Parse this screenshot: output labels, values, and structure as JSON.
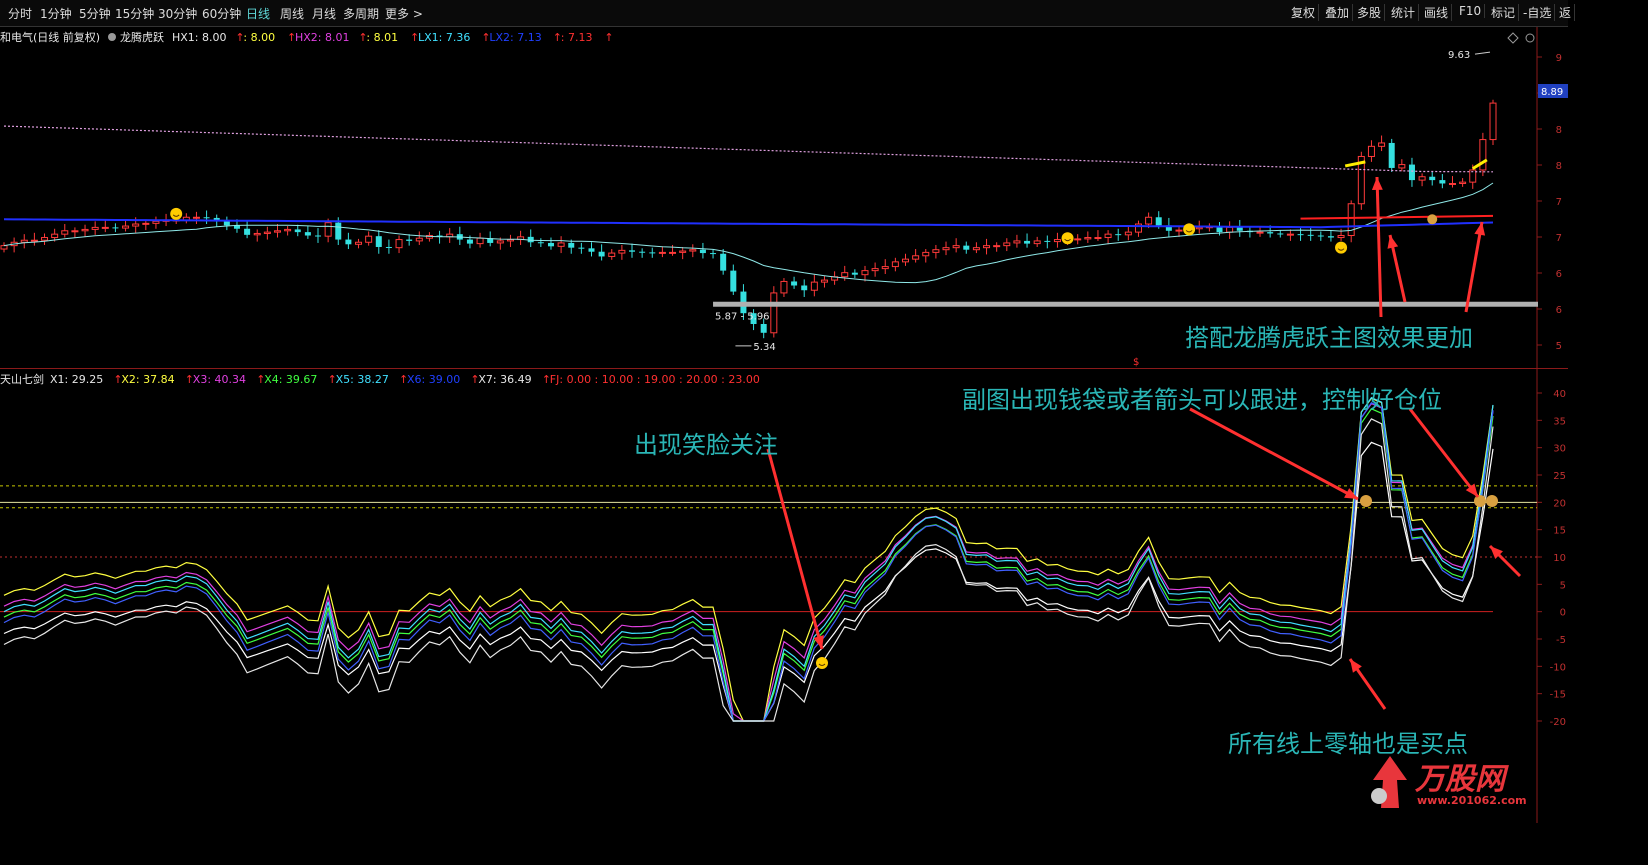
{
  "toolbar": {
    "periods": [
      "分时",
      "1分钟",
      "5分钟",
      "15分钟",
      "30分钟",
      "60分钟",
      "日线",
      "周线",
      "月线",
      "多周期",
      "更多 >"
    ],
    "active": "日线",
    "right_buttons": [
      "复权",
      "叠加",
      "多股",
      "统计",
      "画线",
      "F10",
      "标记",
      "-自选",
      "返"
    ]
  },
  "main_legend": {
    "stock": "和电气(日线 前复权)",
    "indicator": "龙腾虎跃",
    "items": [
      {
        "label": "HX1: 8.00",
        "color": "#e6e6e6"
      },
      {
        "label": "↑",
        "color": "#ff3030"
      },
      {
        "label": ": 8.00",
        "color": "#ffff40"
      },
      {
        "label": "↑",
        "color": "#ff3030"
      },
      {
        "label": "HX2: 8.01",
        "color": "#e040e0"
      },
      {
        "label": "↑",
        "color": "#ff3030"
      },
      {
        "label": ": 8.01",
        "color": "#ffff40"
      },
      {
        "label": "↑",
        "color": "#ff3030"
      },
      {
        "label": "LX1: 7.36",
        "color": "#40e0ff"
      },
      {
        "label": "↑",
        "color": "#ff3030"
      },
      {
        "label": "LX2: 7.13",
        "color": "#2040ff"
      },
      {
        "label": "↑",
        "color": "#ff3030"
      },
      {
        "label": ": 7.13",
        "color": "#ff3030"
      },
      {
        "label": "↑",
        "color": "#ff3030"
      }
    ]
  },
  "main_chart": {
    "price_axis_ticks": [
      "9",
      "9",
      "8",
      "8",
      "7",
      "7",
      "6",
      "6",
      "5"
    ],
    "current_price": "8.89",
    "high_label": "9.63",
    "low_label": "5.34",
    "support_label": "5.87 - 5.96",
    "s_marker": "$"
  },
  "sub_legend": {
    "indicator": "天山七剑",
    "items": [
      {
        "label": "X1: 29.25",
        "color": "#e6e6e6"
      },
      {
        "label": "↑",
        "color": "#ff3030"
      },
      {
        "label": "X2: 37.84",
        "color": "#ffff40"
      },
      {
        "label": "↑",
        "color": "#ff3030"
      },
      {
        "label": "X3: 40.34",
        "color": "#e040e0"
      },
      {
        "label": "↑",
        "color": "#ff3030"
      },
      {
        "label": "X4: 39.67",
        "color": "#40ff40"
      },
      {
        "label": "↑",
        "color": "#ff3030"
      },
      {
        "label": "X5: 38.27",
        "color": "#40e0ff"
      },
      {
        "label": "↑",
        "color": "#ff3030"
      },
      {
        "label": "X6: 39.00",
        "color": "#2040ff"
      },
      {
        "label": "↑",
        "color": "#ff3030"
      },
      {
        "label": "X7: 36.49",
        "color": "#e6e6e6"
      },
      {
        "label": "↑",
        "color": "#ff3030"
      },
      {
        "label": "FJ: 0.00 : 10.00 : 19.00 : 20.00 : 23.00",
        "color": "#ff3030"
      }
    ],
    "axis_ticks": [
      "40",
      "35",
      "30",
      "25",
      "20",
      "15",
      "10",
      "5",
      "0",
      "-5",
      "-10",
      "-15",
      "-20"
    ]
  },
  "chart_data": {
    "type": "candlestick",
    "closes": [
      6.78,
      6.83,
      6.86,
      6.86,
      6.9,
      6.95,
      7.0,
      7.0,
      7.02,
      7.05,
      7.05,
      7.04,
      7.07,
      7.1,
      7.11,
      7.14,
      7.16,
      7.16,
      7.2,
      7.2,
      7.19,
      7.14,
      7.08,
      7.03,
      6.94,
      6.96,
      6.98,
      7.0,
      7.02,
      6.98,
      6.93,
      6.92,
      7.12,
      6.87,
      6.8,
      6.83,
      6.92,
      6.76,
      6.75,
      6.87,
      6.85,
      6.89,
      6.93,
      6.91,
      6.95,
      6.87,
      6.81,
      6.89,
      6.82,
      6.85,
      6.87,
      6.91,
      6.83,
      6.82,
      6.77,
      6.82,
      6.75,
      6.74,
      6.69,
      6.62,
      6.67,
      6.71,
      6.69,
      6.68,
      6.67,
      6.68,
      6.68,
      6.7,
      6.72,
      6.67,
      6.66,
      6.41,
      6.1,
      5.78,
      5.62,
      5.49,
      6.08,
      6.25,
      6.19,
      6.12,
      6.24,
      6.27,
      6.32,
      6.38,
      6.35,
      6.41,
      6.44,
      6.47,
      6.54,
      6.58,
      6.63,
      6.68,
      6.72,
      6.75,
      6.78,
      6.72,
      6.75,
      6.78,
      6.78,
      6.82,
      6.85,
      6.81,
      6.85,
      6.84,
      6.87,
      6.87,
      6.88,
      6.9,
      6.9,
      6.95,
      6.94,
      6.98,
      7.1,
      7.2,
      7.08,
      7.0,
      7.01,
      7.03,
      7.05,
      7.06,
      6.98,
      7.05,
      7.0,
      6.98,
      6.98,
      6.96,
      6.95,
      6.95,
      6.94,
      6.93,
      6.92,
      6.9,
      6.93,
      7.4,
      8.1,
      8.25,
      8.3,
      7.93,
      7.98,
      7.75,
      7.8,
      7.75,
      7.7,
      7.7,
      7.72,
      7.9,
      8.35,
      8.89
    ],
    "sub_axis_range": [
      -20,
      40
    ],
    "reference_levels": [
      23,
      20,
      19,
      10,
      0
    ]
  },
  "annotations": [
    {
      "id": "main-note",
      "text": "搭配龙腾虎跃主图效果更加"
    },
    {
      "id": "sub-note",
      "text": "副图出现钱袋或者箭头可以跟进，控制好仓位"
    },
    {
      "id": "smile-note",
      "text": "出现笑脸关注"
    },
    {
      "id": "zero-note",
      "text": "所有线上零轴也是买点"
    }
  ],
  "logo": {
    "name": "万股网",
    "url": "www.201062.com"
  }
}
